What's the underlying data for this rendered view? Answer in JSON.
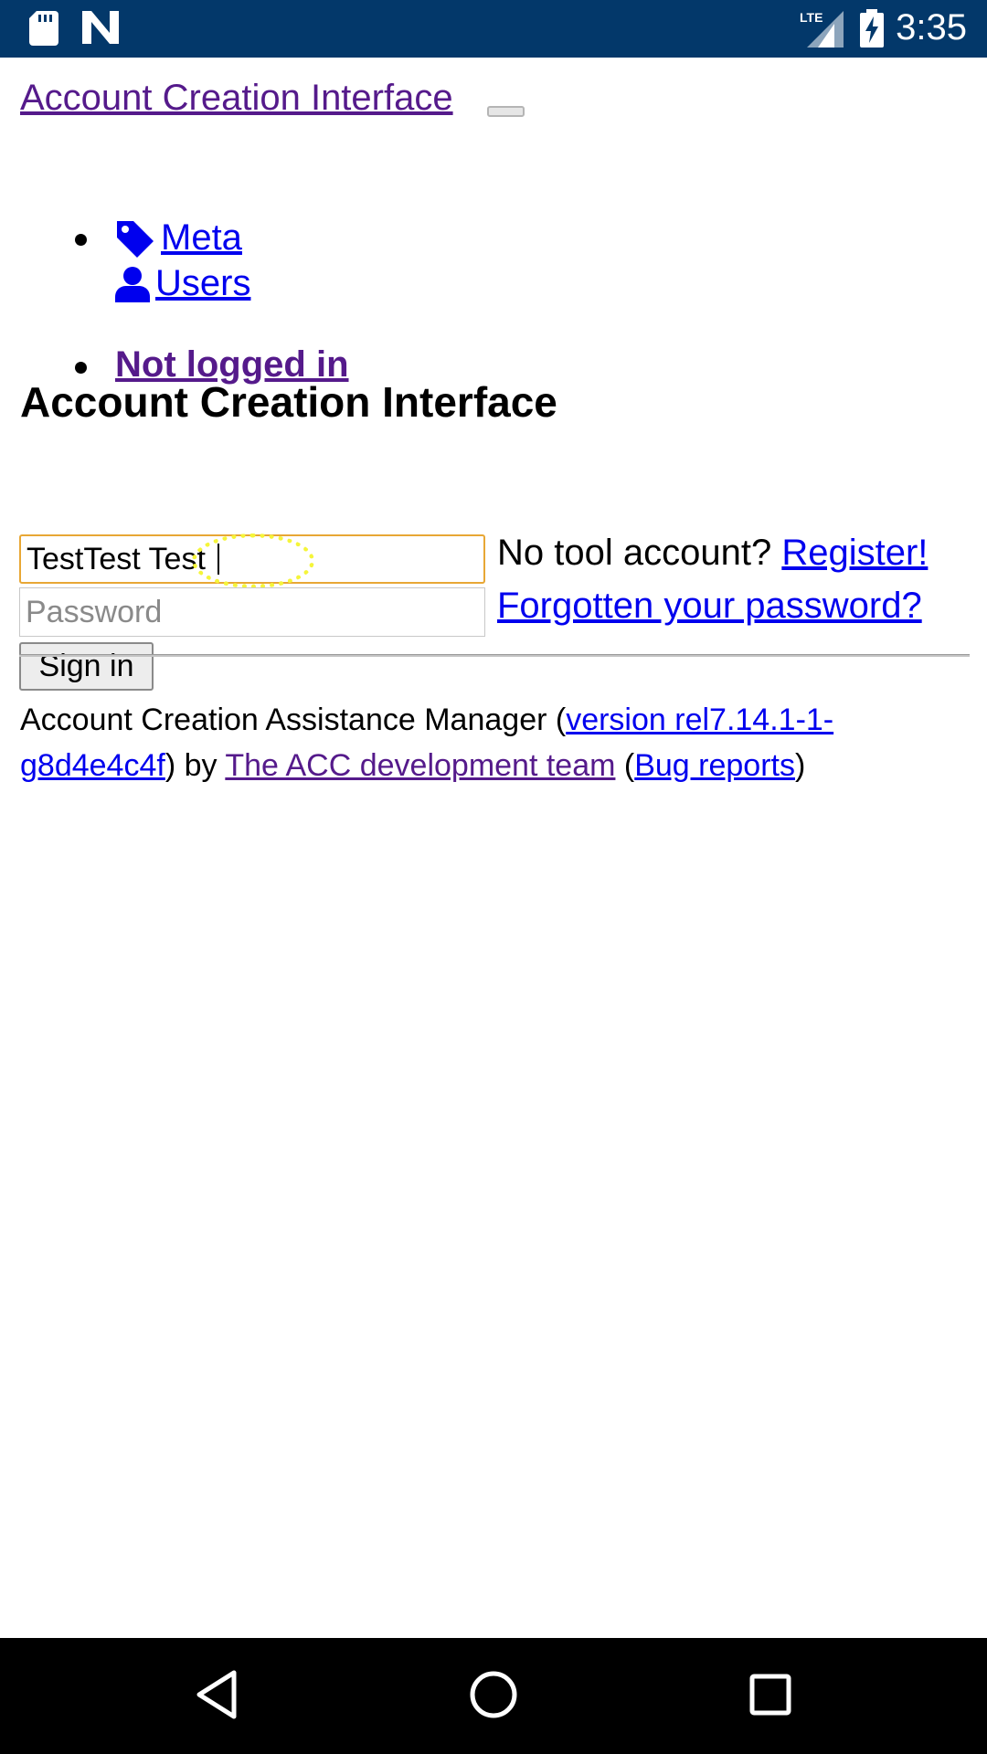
{
  "status_bar": {
    "time": "3:35",
    "network": "LTE",
    "icons": [
      "sd-card-icon",
      "n-logo-icon",
      "lte-signal-icon",
      "battery-charging-icon"
    ]
  },
  "header": {
    "brand": "Account Creation Interface",
    "nav": [
      {
        "icon": "tag-icon",
        "label": "Meta"
      },
      {
        "icon": "user-icon",
        "label": "Users"
      }
    ],
    "login_status": "Not logged in"
  },
  "main": {
    "heading": "Account Creation Interface",
    "login": {
      "username_value": "TestTest Test",
      "password_placeholder": "Password",
      "signin_label": "Sign in"
    },
    "side": {
      "no_account_text": "No tool account?",
      "register_link": "Register!",
      "forgot_link": "Forgotten your password?"
    }
  },
  "footer": {
    "prefix": "Account Creation Assistance Manager (",
    "version_link": "version rel7.14.1-1-g8d4e4c4f",
    "middle": ") by ",
    "team_link": "The ACC development team",
    "sep": " (",
    "bug_link": "Bug reports",
    "suffix": ")"
  },
  "colors": {
    "status_bar_bg": "#03386a",
    "link": "#0000ee",
    "visited_link": "#551a8b",
    "focus_border": "#e8a735",
    "tap_indicator": "#f5f53a"
  }
}
